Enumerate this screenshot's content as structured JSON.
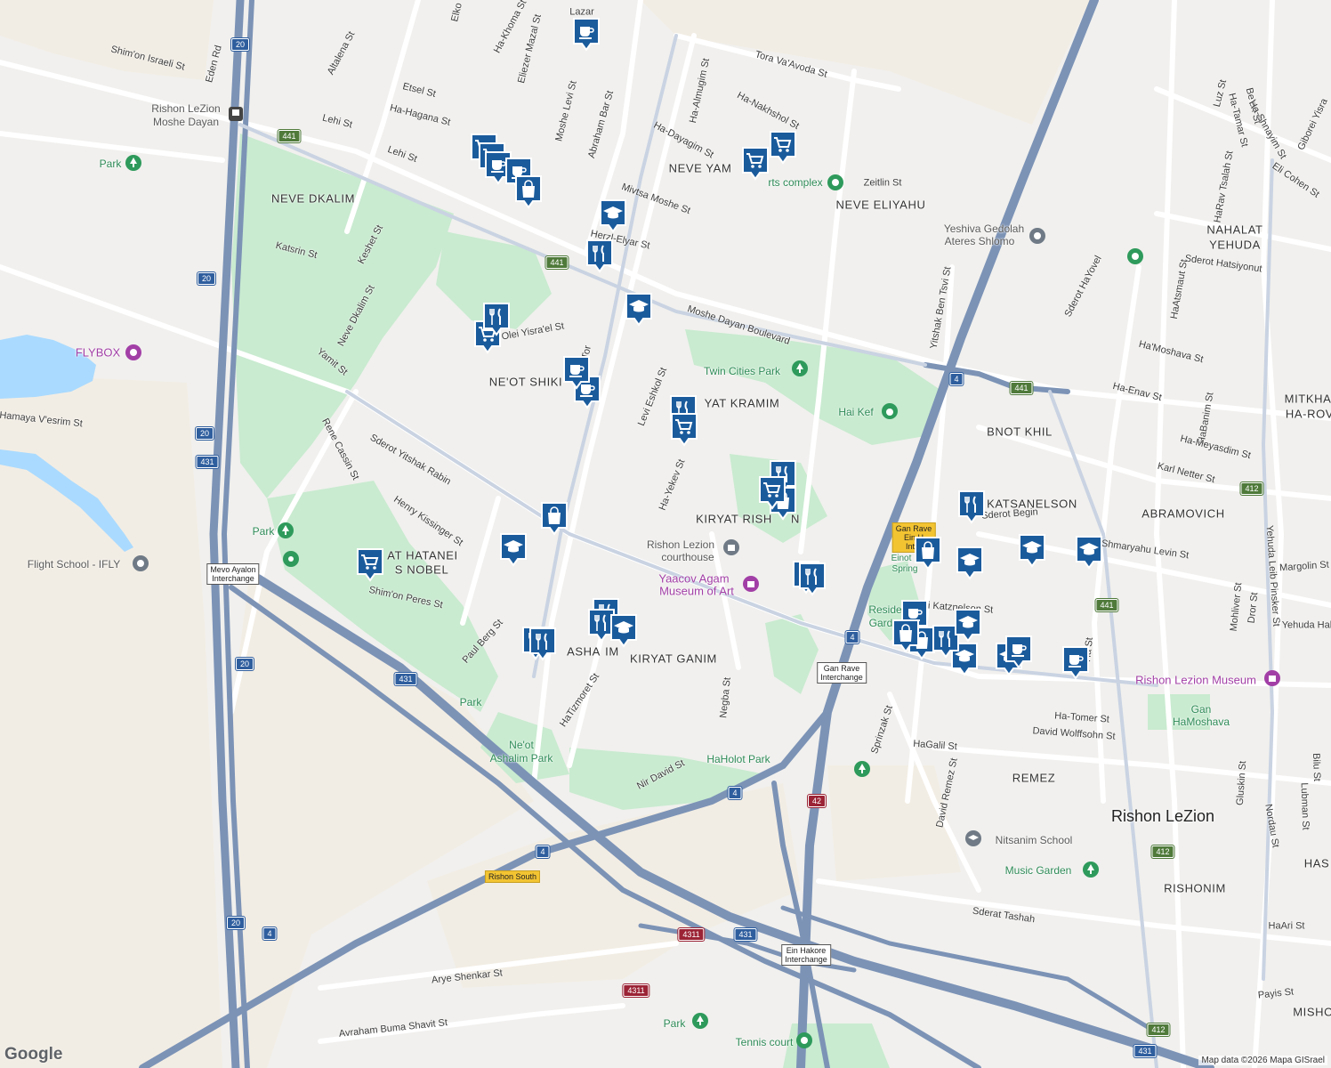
{
  "colors": {
    "background": "#f1f0ee",
    "desert": "#f2ede4",
    "park": "#c9ebd0",
    "water": "#aadaff",
    "highway": "#7c93b6",
    "road": "#ffffff",
    "marker": "#1a5b9c",
    "park_icon": "#2e9a5b",
    "museum_icon": "#a23fa6",
    "school_icon": "#6f7a86"
  },
  "labels": {
    "cities": [
      "Rishon LeZion"
    ],
    "neighborhoods": [
      "NEVE DKALIM",
      "NEVE YAM",
      "NEVE ELIYAHU",
      "NAHALAT",
      "YEHUDA",
      "NE'OT SHIKI",
      "YAT KRAMIM",
      "BNOT KHIL",
      "MITKHA",
      "HA-ROV",
      "KIRYAT RISH",
      "N",
      "KATSANELSON",
      "ABRAMOVICH",
      "AT HATANEI",
      "S NOBEL",
      "ASHA",
      "IM",
      "KIRYAT GANIM",
      "REMEZ",
      "RISHONIM",
      "HAS",
      "MISHO"
    ],
    "streets": [
      "Shim'on Israeli St",
      "Eden Rd",
      "Altalena St",
      "Etsel St",
      "Ha-Hagana St",
      "Lehi St",
      "Lehi St",
      "Moshe Levi St",
      "Eliezer Mazal St",
      "Ha-Khoma St",
      "Abraham Bar St",
      "Tora Va'Avoda St",
      "Ha-Almugim St",
      "Ha-Dayagim St",
      "Ha-Nakhshol St",
      "Mivtsa Moshe St",
      "Herzl-Elyar St",
      "Zeitlin St",
      "Katsrin St",
      "Keshet St",
      "Neve Dkalim St",
      "Yamit St",
      "Moshe Dayan Boulevard",
      "Olei Yisra'el St",
      "Tor",
      "Levi Eshkol St",
      "Sderot Yitshak Rabin",
      "Rene Cassin St",
      "Henry Kissinger St",
      "Shim'on Peres St",
      "Paul Berg St",
      "Ha-Yekev St",
      "HaTizmoret St",
      "Negba St",
      "Nir David St",
      "Yitshak Ben Tsvi St",
      "Sderot HaYovel",
      "Sderot Hatsiyonut",
      "Ha'Moshava St",
      "Ha-Enav St",
      "HaBanim St",
      "Ha-Meyasdim St",
      "Karl Netter St",
      "Sderot Begin",
      "Shmaryahu Levin St",
      "Margolin St",
      "Beri Katznelson St",
      "Mohliver St",
      "Dror St",
      "Yehuda Leib Pinsker St",
      "Yehuda Hale",
      "Ha-Tomer St",
      "David Wolffsohn St",
      "HaGalil St",
      "Sprinzak St",
      "David Remez St",
      "Gluskin St",
      "Nordau St",
      "Lubman St",
      "Bilu St",
      "Sderat Tashah",
      "HaAri St",
      "Payis St",
      "Arye Shenkar St",
      "Avraham Buma Shavit St",
      "Hamaya V'esrim St",
      "Luz St",
      "Ha-Tamar St",
      "Be'eri St",
      "Ha-Shnayim St",
      "Giborei Yisra",
      "Eli Cohen St",
      "HaRav Tsalah St",
      "HaAtsmaut St",
      "Lazar",
      "Elko",
      "Ha St"
    ],
    "parks": [
      "Park",
      "Park",
      "Park",
      "Twin Cities Park",
      "Hai Kef",
      "Ne'ot",
      "Ashalim Park",
      "HaHolot Park",
      "Gan",
      "HaMoshava",
      "Music Garden",
      "Park",
      "Tennis court",
      "Resident",
      "Gard",
      "Einot",
      "Spring",
      "rts complex"
    ],
    "museums": [
      "FLYBOX",
      "Yaacov Agam",
      "Museum of Art",
      "Rishon Lezion Museum"
    ],
    "places": [
      "Rishon LeZion",
      "Moshe Dayan",
      "Flight School - IFLY",
      "Rishon Lezion",
      "courthouse",
      "Yeshiva Gedolah",
      "Ateres Shlomo",
      "Nitsanim School"
    ]
  },
  "interchanges": [
    {
      "line1": "Mevo Ayalon",
      "line2": "Interchange"
    },
    {
      "line1": "Gan Rave",
      "line2": "Interchange"
    },
    {
      "line1": "Ein Hakore",
      "line2": "Interchange"
    }
  ],
  "yellow_tags": [
    {
      "line1": "Gan Rave",
      "line2": "Ein H",
      "line3": "Inter"
    },
    {
      "line1": "Rishon South"
    }
  ],
  "route_shields": [
    "20",
    "20",
    "20",
    "20",
    "20",
    "441",
    "441",
    "441",
    "441",
    "4",
    "4",
    "4",
    "4",
    "4",
    "431",
    "431",
    "431",
    "431",
    "42",
    "4311",
    "4311",
    "412",
    "412",
    "412",
    "431",
    "441"
  ],
  "markers": [
    {
      "kind": "cafe",
      "icon": "coffee-cup-icon"
    },
    {
      "kind": "shopping",
      "icon": "shopping-cart-icon"
    },
    {
      "kind": "shopping",
      "icon": "shopping-cart-icon"
    },
    {
      "kind": "cafe",
      "icon": "coffee-cup-icon"
    },
    {
      "kind": "cafe",
      "icon": "coffee-cup-icon"
    },
    {
      "kind": "shopping",
      "icon": "shopping-bag-icon"
    },
    {
      "kind": "shopping",
      "icon": "shopping-cart-icon"
    },
    {
      "kind": "school",
      "icon": "graduation-cap-icon"
    },
    {
      "kind": "restaurant",
      "icon": "fork-knife-icon"
    },
    {
      "kind": "school",
      "icon": "graduation-cap-icon"
    },
    {
      "kind": "restaurant",
      "icon": "fork-knife-icon"
    },
    {
      "kind": "shopping",
      "icon": "shopping-cart-icon"
    },
    {
      "kind": "shopping",
      "icon": "shopping-cart-icon"
    },
    {
      "kind": "cafe",
      "icon": "coffee-cup-icon"
    },
    {
      "kind": "restaurant",
      "icon": "fork-knife-icon"
    },
    {
      "kind": "shopping",
      "icon": "shopping-cart-icon"
    },
    {
      "kind": "school",
      "icon": "graduation-cap-icon"
    },
    {
      "kind": "shopping",
      "icon": "shopping-cart-icon"
    },
    {
      "kind": "restaurant",
      "icon": "fork-knife-icon"
    },
    {
      "kind": "shopping",
      "icon": "shopping-bag-icon"
    },
    {
      "kind": "shopping",
      "icon": "shopping-bag-icon"
    },
    {
      "kind": "school",
      "icon": "graduation-cap-icon"
    },
    {
      "kind": "shopping",
      "icon": "shopping-cart-icon"
    },
    {
      "kind": "restaurant",
      "icon": "fork-knife-icon"
    },
    {
      "kind": "restaurant",
      "icon": "fork-knife-icon"
    },
    {
      "kind": "restaurant",
      "icon": "fork-knife-icon"
    },
    {
      "kind": "school",
      "icon": "graduation-cap-icon"
    },
    {
      "kind": "restaurant",
      "icon": "fork-knife-icon"
    },
    {
      "kind": "restaurant",
      "icon": "fork-knife-icon"
    },
    {
      "kind": "restaurant",
      "icon": "fork-knife-icon"
    },
    {
      "kind": "restaurant",
      "icon": "fork-knife-icon"
    },
    {
      "kind": "shopping",
      "icon": "shopping-bag-icon"
    },
    {
      "kind": "school",
      "icon": "graduation-cap-icon"
    },
    {
      "kind": "school",
      "icon": "graduation-cap-icon"
    },
    {
      "kind": "school",
      "icon": "graduation-cap-icon"
    },
    {
      "kind": "shopping",
      "icon": "shopping-bag-icon"
    },
    {
      "kind": "cafe",
      "icon": "coffee-cup-icon"
    },
    {
      "kind": "shopping",
      "icon": "shopping-bag-icon"
    },
    {
      "kind": "restaurant",
      "icon": "fork-knife-icon"
    },
    {
      "kind": "school",
      "icon": "graduation-cap-icon"
    },
    {
      "kind": "school",
      "icon": "graduation-cap-icon"
    },
    {
      "kind": "cafe",
      "icon": "coffee-cup-icon"
    },
    {
      "kind": "cafe",
      "icon": "coffee-cup-icon"
    },
    {
      "kind": "cafe",
      "icon": "coffee-cup-icon"
    }
  ],
  "station": {
    "icon": "train-station-icon"
  },
  "footer": {
    "logo": "Google",
    "attribution": "Map data ©2026 Mapa GISrael"
  }
}
